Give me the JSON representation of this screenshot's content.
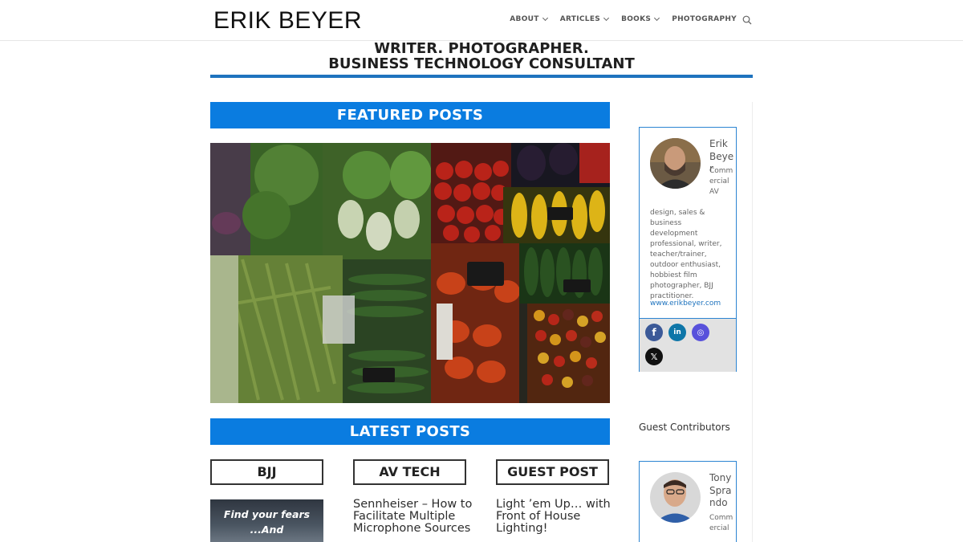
{
  "site": {
    "logo": "ERIK BEYER",
    "nav": [
      {
        "label": "ABOUT",
        "has_dropdown": true
      },
      {
        "label": "ARTICLES",
        "has_dropdown": true
      },
      {
        "label": "BOOKS",
        "has_dropdown": true
      },
      {
        "label": "PHOTOGRAPHY",
        "has_dropdown": false
      }
    ],
    "search_icon": "search-icon"
  },
  "tagline": {
    "line1": "WRITER. PHOTOGRAPHER.",
    "line2": "BUSINESS TECHNOLOGY CONSULTANT"
  },
  "main": {
    "featured_heading": "FEATURED POSTS",
    "featured_image": "market vegetable stall photo",
    "latest_heading": "LATEST POSTS",
    "categories": [
      {
        "label": "BJJ",
        "post_title": "",
        "thumb_line1": "Find your fears",
        "thumb_line2": "...And"
      },
      {
        "label": "AV TECH",
        "post_title": "Sennheiser – How to Facilitate Multiple Microphone Sources"
      },
      {
        "label": "GUEST POST",
        "post_title": "Light ’em Up… with Front of House Lighting!"
      }
    ]
  },
  "sidebar": {
    "author": {
      "name": "Erik Beyer",
      "bio_narrow": "Commercial AV",
      "bio_wide": "design, sales & business development professional, writer, teacher/trainer, outdoor enthusiast, hobbiest film photographer, BJJ practitioner.",
      "link": "www.erikbeyer.com",
      "social": [
        "facebook-icon",
        "linkedin-icon",
        "instagram-icon",
        "x-icon"
      ]
    },
    "guest_label": "Guest Contributors",
    "guest": {
      "name": "Tony Sprando",
      "bio_narrow": "Commercial"
    }
  },
  "colors": {
    "accent_blue": "#0a7ce0",
    "rule_blue": "#1e73be",
    "card_border": "#2b84d2"
  }
}
